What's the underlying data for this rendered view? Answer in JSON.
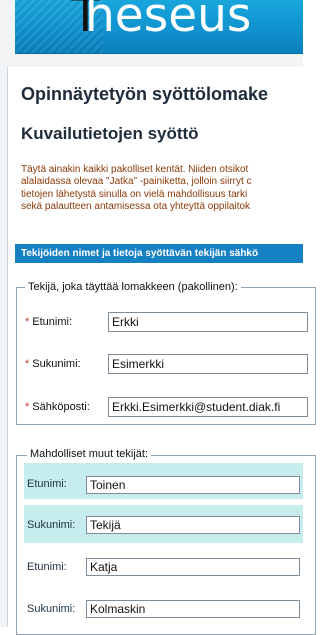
{
  "header": {
    "logo_text": "heseus",
    "logo_letter": "T"
  },
  "page": {
    "title": "Opinnäytetyön syöttölomake",
    "section_title": "Kuvailutietojen syöttö",
    "intro_lines": [
      "Täytä ainakin kaikki pakolliset kentät. Niiden otsikot",
      "alalaidassa olevaa \"Jatka\" -painiketta, jolloin siirryt c",
      "tietojen lähetystä sinulla on vielä mahdollisuus tarki",
      "sekä palautteen antamisessa ota yhteyttä oppilaitok"
    ],
    "section_bar": "Tekijöiden nimet ja tietoja syöttävän tekijän sähkö"
  },
  "required_author": {
    "legend": "Tekijä, joka täyttää lomakkeen (pakollinen):",
    "required_marker": "*",
    "first_name_label": "Etunimi:",
    "first_name_value": "Erkki",
    "last_name_label": "Sukunimi:",
    "last_name_value": "Esimerkki",
    "email_label": "Sähköposti:",
    "email_value": "Erkki.Esimerkki@student.diak.fi"
  },
  "other_authors": {
    "legend": "Mahdolliset muut tekijät:",
    "rows": [
      {
        "label": "Etunimi:",
        "value": "Toinen"
      },
      {
        "label": "Sukunimi:",
        "value": "Tekijä"
      },
      {
        "label": "Etunimi:",
        "value": "Katja"
      },
      {
        "label": "Sukunimi:",
        "value": "Kolmaskin"
      }
    ]
  },
  "colors": {
    "banner_blue": "#0f93cf",
    "section_bar": "#1680c4",
    "row_tint": "#c6ecee",
    "intro_text": "#8b3a08",
    "required_star": "#c0392b"
  }
}
